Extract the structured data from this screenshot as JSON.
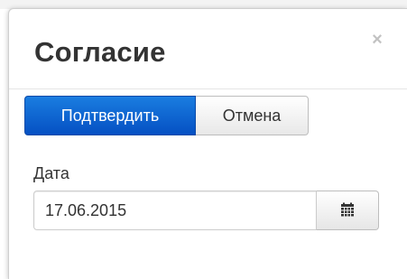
{
  "dialog": {
    "title": "Согласие",
    "close_symbol": "×",
    "close_icon": "close-icon"
  },
  "actions": {
    "confirm_label": "Подтвердить",
    "cancel_label": "Отмена",
    "confirm_color": "#0b5fd3"
  },
  "date_field": {
    "label": "Дата",
    "value": "17.06.2015",
    "icon": "calendar-icon"
  }
}
